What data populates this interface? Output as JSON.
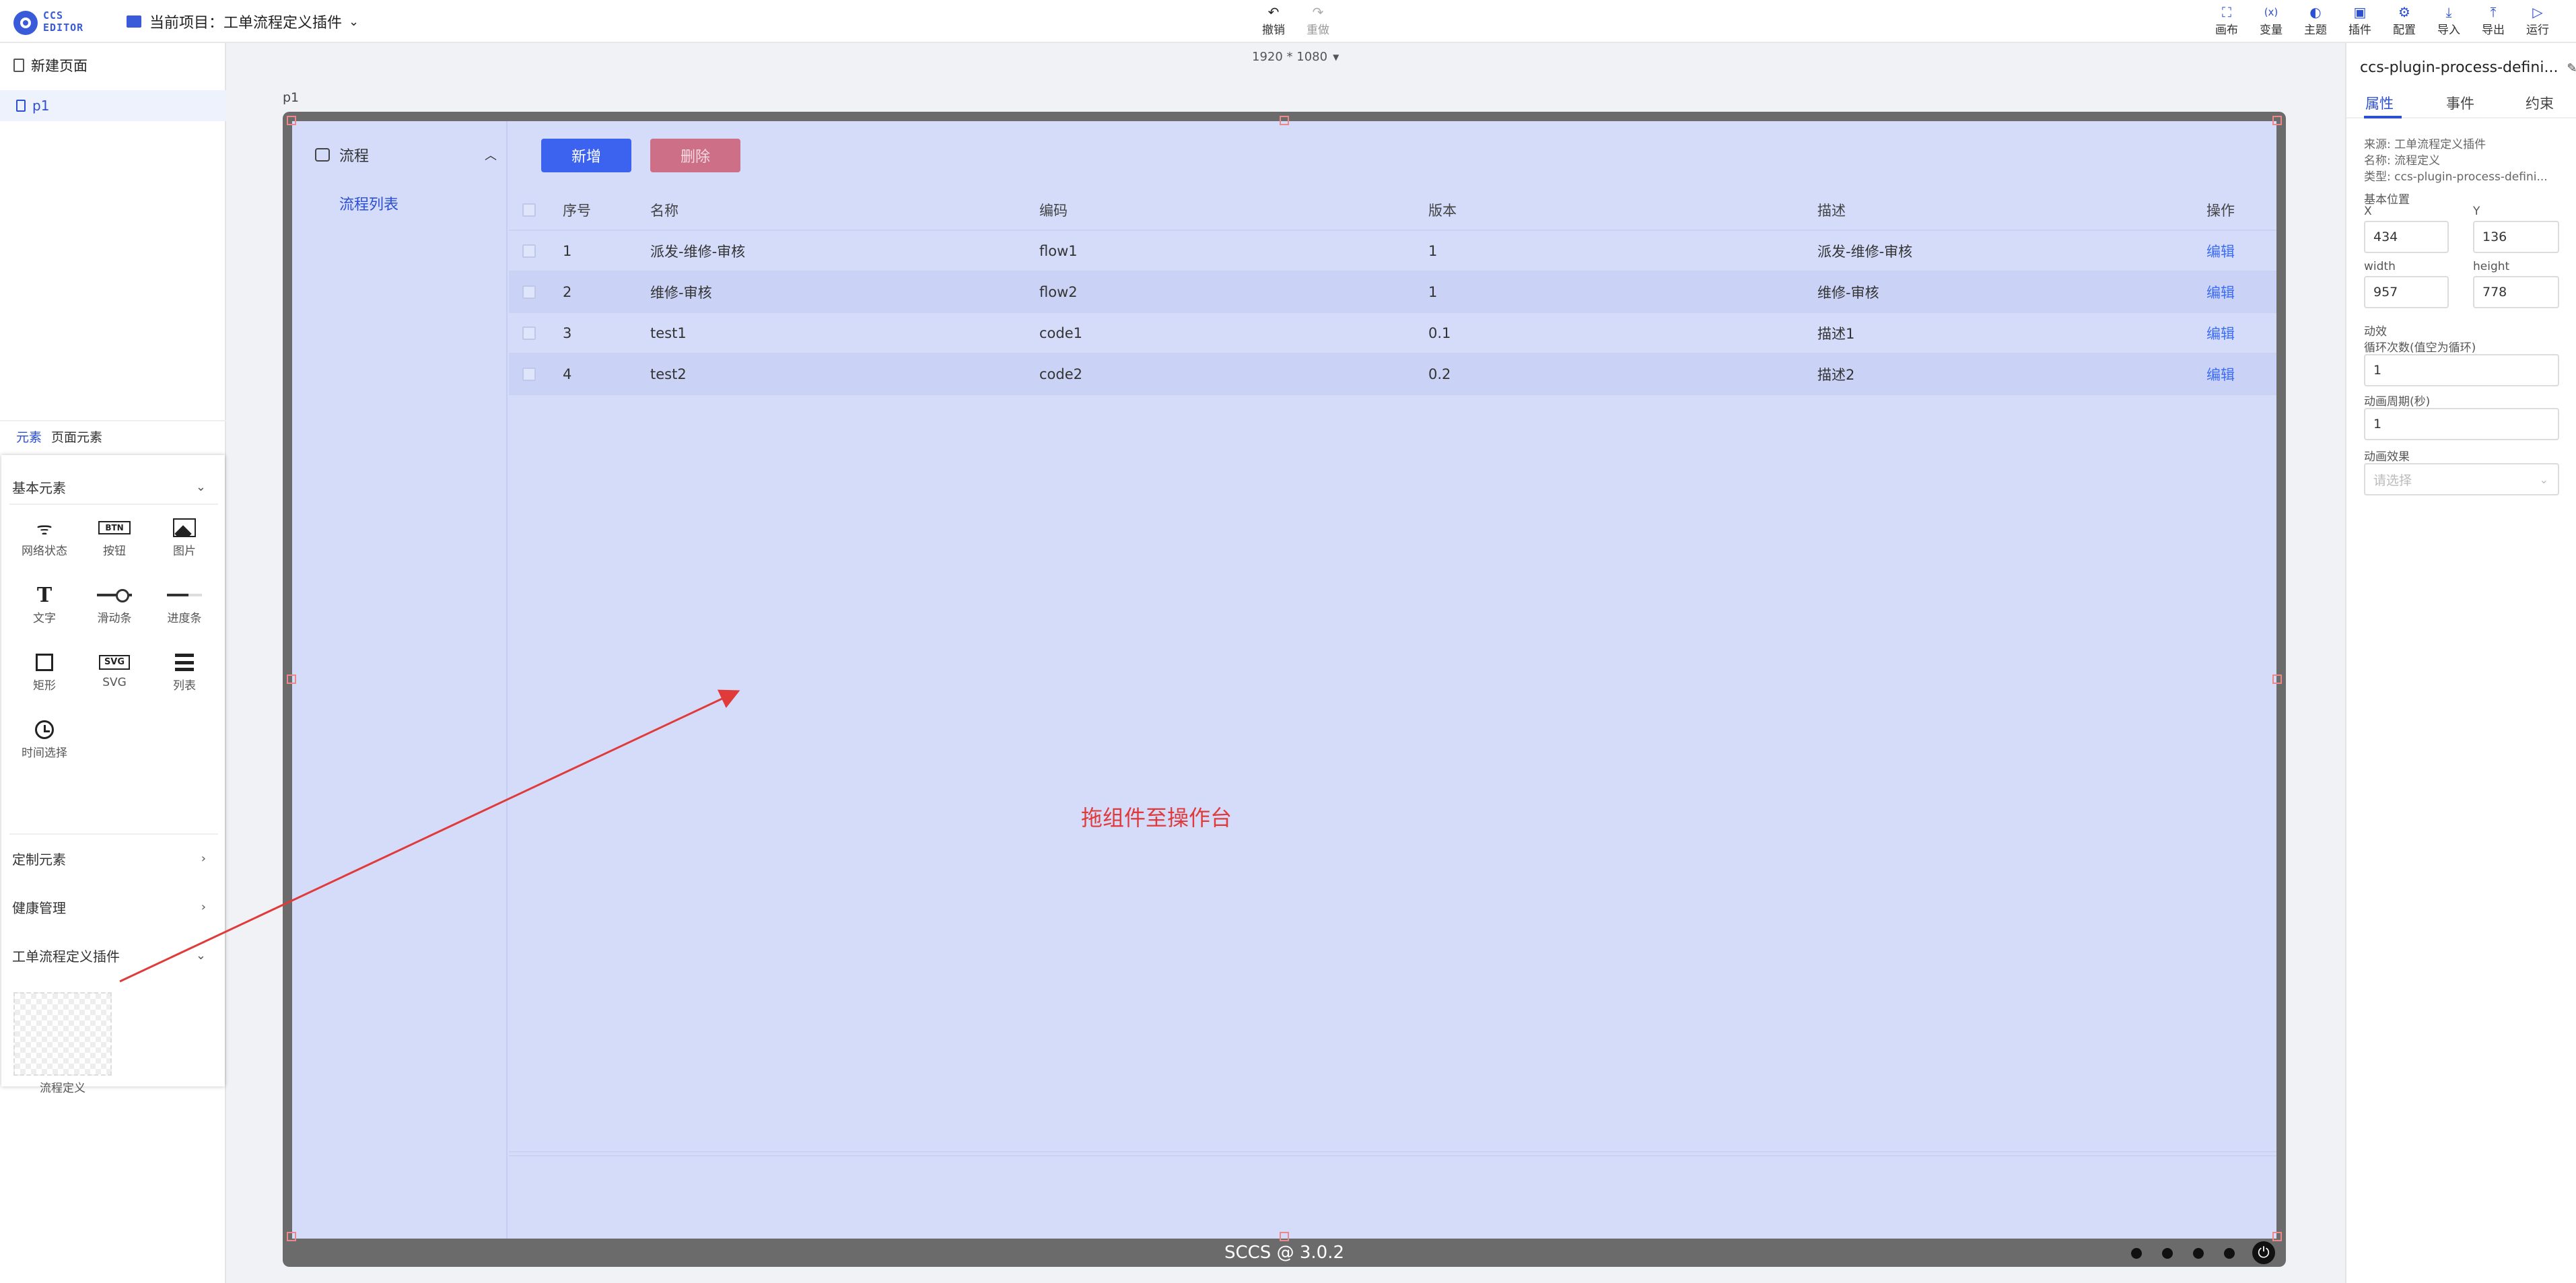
{
  "app": {
    "logo_line1": "CCS",
    "logo_line2": "EDITOR",
    "project_label": "当前项目：工单流程定义插件"
  },
  "toolbar": {
    "undo": "撤销",
    "redo": "重做",
    "right_tools": [
      {
        "icon": "canvas-icon",
        "label": "画布"
      },
      {
        "icon": "variable-icon",
        "label": "变量"
      },
      {
        "icon": "theme-icon",
        "label": "主题"
      },
      {
        "icon": "plugin-icon",
        "label": "插件"
      },
      {
        "icon": "config-icon",
        "label": "配置"
      },
      {
        "icon": "import-icon",
        "label": "导入"
      },
      {
        "icon": "export-icon",
        "label": "导出"
      },
      {
        "icon": "run-icon",
        "label": "运行"
      }
    ]
  },
  "pages": {
    "new_page": "新建页面",
    "items": [
      "p1"
    ]
  },
  "elements_panel": {
    "tabs": [
      "元素",
      "页面元素"
    ],
    "groups": [
      {
        "title": "基本元素",
        "expanded": true
      },
      {
        "title": "定制元素",
        "expanded": false
      },
      {
        "title": "健康管理",
        "expanded": false
      },
      {
        "title": "工单流程定义插件",
        "expanded": true
      }
    ],
    "basic_widgets": [
      {
        "icon": "wifi-icon",
        "label": "网络状态"
      },
      {
        "icon": "button-icon",
        "label": "按钮",
        "glyph": "BTN"
      },
      {
        "icon": "image-icon",
        "label": "图片"
      },
      {
        "icon": "text-icon",
        "label": "文字",
        "glyph": "T"
      },
      {
        "icon": "slider-icon",
        "label": "滑动条"
      },
      {
        "icon": "progress-icon",
        "label": "进度条"
      },
      {
        "icon": "rectangle-icon",
        "label": "矩形"
      },
      {
        "icon": "svg-icon",
        "label": "SVG",
        "glyph": "SVG"
      },
      {
        "icon": "list-icon",
        "label": "列表"
      },
      {
        "icon": "clock-icon",
        "label": "时间选择"
      }
    ],
    "plugin_widget": {
      "label": "流程定义"
    }
  },
  "canvas": {
    "size": "1920 * 1080",
    "page_name": "p1",
    "footer": "SCCS @ 3.0.2",
    "hint": "拖组件至操作台"
  },
  "app_preview": {
    "menu_title": "流程",
    "menu_item": "流程列表",
    "add_button": "新增",
    "delete_button": "删除",
    "columns": [
      "序号",
      "名称",
      "编码",
      "版本",
      "描述",
      "操作"
    ],
    "rows": [
      {
        "idx": "1",
        "name": "派发-维修-审核",
        "code": "flow1",
        "version": "1",
        "desc": "派发-维修-审核",
        "op": "编辑"
      },
      {
        "idx": "2",
        "name": "维修-审核",
        "code": "flow2",
        "version": "1",
        "desc": "维修-审核",
        "op": "编辑"
      },
      {
        "idx": "3",
        "name": "test1",
        "code": "code1",
        "version": "0.1",
        "desc": "描述1",
        "op": "编辑"
      },
      {
        "idx": "4",
        "name": "test2",
        "code": "code2",
        "version": "0.2",
        "desc": "描述2",
        "op": "编辑"
      }
    ]
  },
  "properties": {
    "component_title": "ccs-plugin-process-defini...",
    "tabs": [
      "属性",
      "事件",
      "约束"
    ],
    "source": "来源: 工单流程定义插件",
    "name": "名称: 流程定义",
    "type": "类型: ccs-plugin-process-defini...",
    "position_title": "基本位置",
    "x_label": "X",
    "y_label": "Y",
    "x_value": "434",
    "y_value": "136",
    "width_label": "width",
    "height_label": "height",
    "width_value": "957",
    "height_value": "778",
    "animation_title": "动效",
    "loop_label": "循环次数(值空为循环)",
    "loop_value": "1",
    "period_label": "动画周期(秒)",
    "period_value": "1",
    "effect_label": "动画效果",
    "effect_placeholder": "请选择"
  },
  "colors": {
    "accent": "#2d4fd1",
    "canvas_bg": "#d4dcfa",
    "add_button": "#3b63f0",
    "delete_button": "#cd6f86",
    "hint_red": "#e03a3a"
  }
}
